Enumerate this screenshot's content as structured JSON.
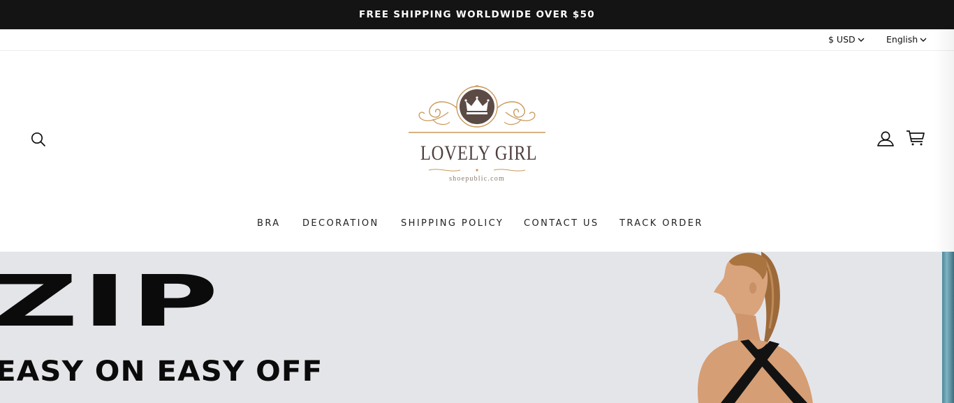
{
  "announcement": {
    "text": "FREE SHIPPING WORLDWIDE OVER $50"
  },
  "utility": {
    "currency": "$ USD",
    "language": "English"
  },
  "header": {
    "search_icon": "search-icon",
    "account_icon": "user-icon",
    "cart_icon": "cart-icon",
    "logo": {
      "title": "LOVELY GIRL",
      "url": "shoepublic.com",
      "emblem": "crown",
      "colors": {
        "gold": "#c9995a",
        "brown": "#5c4a45"
      }
    }
  },
  "nav": {
    "items": [
      {
        "label": "BRA"
      },
      {
        "label": "DECORATION"
      },
      {
        "label": "SHIPPING POLICY"
      },
      {
        "label": "CONTACT US"
      },
      {
        "label": "TRACK ORDER"
      }
    ]
  },
  "hero": {
    "headline": "ZIP",
    "subheadline": "EASY ON EASY OFF",
    "background": "#e4e5e9"
  },
  "colors": {
    "announcement_bg": "#141414",
    "text": "#111111"
  }
}
